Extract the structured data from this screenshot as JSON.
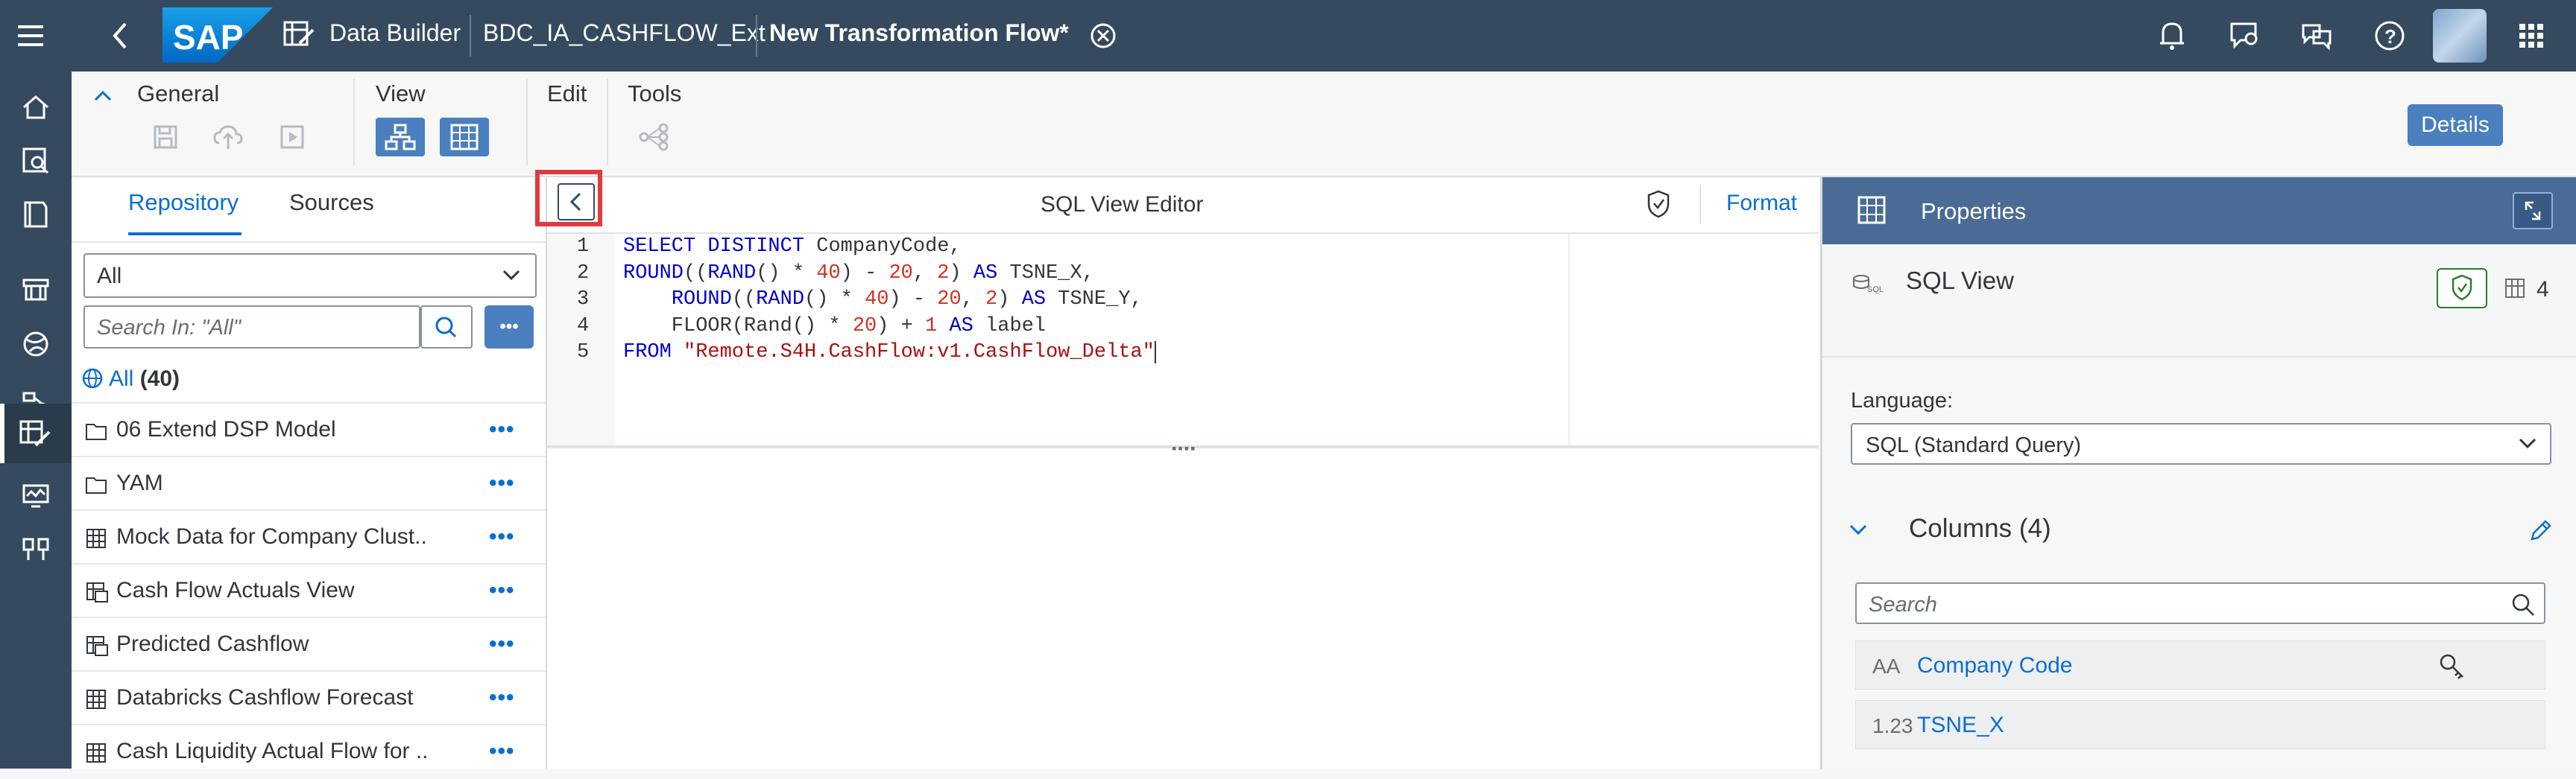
{
  "shell": {
    "logo": "SAP",
    "app_name": "Data Builder",
    "space": "BDC_IA_CASHFLOW_Ext",
    "tab_title": "New Transformation Flow",
    "tab_modified_marker": "*"
  },
  "toolbar": {
    "groups": {
      "general": "General",
      "view": "View",
      "edit": "Edit",
      "tools": "Tools"
    },
    "details_label": "Details"
  },
  "repo": {
    "tabs": [
      "Repository",
      "Sources"
    ],
    "active_tab": "Repository",
    "filter_value": "All",
    "search_placeholder": "Search In: \"All\"",
    "all_label": "All",
    "all_count": "(40)",
    "items": [
      {
        "label": "06 Extend DSP Model",
        "icon": "folder-icon"
      },
      {
        "label": "YAM",
        "icon": "folder-icon"
      },
      {
        "label": "Mock Data for Company Clust..",
        "icon": "table-icon"
      },
      {
        "label": "Cash Flow Actuals View",
        "icon": "view-icon"
      },
      {
        "label": "Predicted Cashflow",
        "icon": "view-icon"
      },
      {
        "label": "Databricks Cashflow Forecast",
        "icon": "table-icon"
      },
      {
        "label": "Cash Liquidity Actual Flow for ..",
        "icon": "table-icon"
      }
    ],
    "more_label": "•••"
  },
  "editor": {
    "title": "SQL View Editor",
    "format_label": "Format",
    "line_numbers": [
      "1",
      "2",
      "3",
      "4",
      "5"
    ]
  },
  "props": {
    "header_title": "Properties",
    "object_name": "SQL View",
    "column_count": "4",
    "language_label": "Language:",
    "language_value": "SQL (Standard Query)",
    "columns_title": "Columns (4)",
    "search_placeholder": "Search",
    "columns": [
      {
        "type_label": "AA",
        "name": "Company Code",
        "key": true
      },
      {
        "type_label": "1.23",
        "name": "TSNE_X",
        "key": false
      }
    ]
  },
  "colors": {
    "shell_bg": "#354a5f",
    "accent": "#0a6ed1",
    "button_blue": "#4a7fc0",
    "highlight_red": "#e03a3e",
    "props_header": "#4a6b96"
  }
}
